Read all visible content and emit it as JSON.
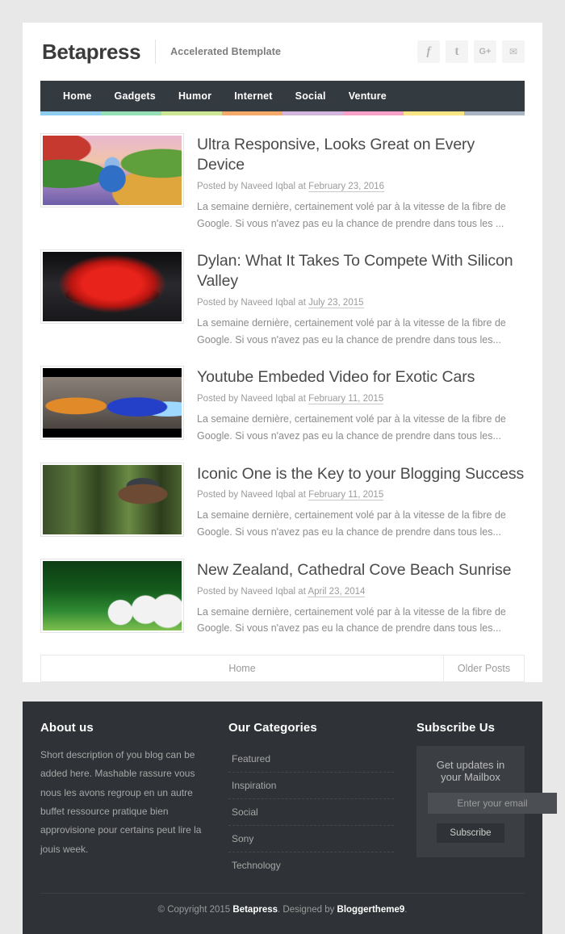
{
  "header": {
    "brand": "Betapress",
    "tagline": "Accelerated Btemplate",
    "social": [
      {
        "name": "facebook-icon",
        "glyph": "f"
      },
      {
        "name": "tumblr-icon",
        "glyph": "t"
      },
      {
        "name": "googleplus-icon",
        "glyph": "G+"
      },
      {
        "name": "email-icon",
        "glyph": "✉"
      }
    ]
  },
  "nav": {
    "items": [
      {
        "label": "Home"
      },
      {
        "label": "Gadgets"
      },
      {
        "label": "Humor"
      },
      {
        "label": "Internet"
      },
      {
        "label": "Social"
      },
      {
        "label": "Venture"
      }
    ],
    "stripe_colors": [
      "#8ecdf0",
      "#97e0b6",
      "#cbe694",
      "#f7a96a",
      "#d3b5de",
      "#f9a0c8",
      "#fbe585",
      "#aab5c4"
    ]
  },
  "posts": [
    {
      "title": "Ultra Responsive, Looks Great on Every Device",
      "meta_prefix": "Posted by Naveed Iqbal at ",
      "date": "February 23, 2016",
      "snippet": "La semaine dernière, certainement volé par à la vitesse de la fibre de Google. Si vous n'avez pas eu la chance de prendre dans tous les ...",
      "thumb": "fantasy-illustration-thumbnail"
    },
    {
      "title": "Dylan: What It Takes To Compete With Silicon Valley",
      "meta_prefix": "Posted by Naveed Iqbal at ",
      "date": "July 23, 2015",
      "snippet": "La semaine dernière, certainement volé par à la vitesse de la fibre de Google. Si vous n'avez pas eu la chance de prendre dans tous les...",
      "thumb": "red-sports-car-thumbnail"
    },
    {
      "title": "Youtube Embeded Video for Exotic Cars",
      "meta_prefix": "Posted by Naveed Iqbal at ",
      "date": "February 11, 2015",
      "snippet": "La semaine dernière, certainement volé par à la vitesse de la fibre de Google. Si vous n'avez pas eu la chance de prendre dans tous les...",
      "thumb": "snail-racer-thumbnail"
    },
    {
      "title": "Iconic One is the Key to your Blogging Success",
      "meta_prefix": "Posted by Naveed Iqbal at ",
      "date": "February 11, 2015",
      "snippet": "La semaine dernière, certainement volé par à la vitesse de la fibre de Google. Si vous n'avez pas eu la chance de prendre dans tous les...",
      "thumb": "forest-treehouse-thumbnail"
    },
    {
      "title": "New Zealand, Cathedral Cove Beach Sunrise",
      "meta_prefix": "Posted by Naveed Iqbal at ",
      "date": "April 23, 2014",
      "snippet": "La semaine dernière, certainement volé par à la vitesse de la fibre de Google. Si vous n'avez pas eu la chance de prendre dans tous les...",
      "thumb": "soccer-balls-thumbnail"
    }
  ],
  "pagination": {
    "home_label": "Home",
    "older_label": "Older Posts"
  },
  "footer": {
    "about": {
      "title": "About us",
      "text": "Short description of you blog can be added here. Mashable rassure vous nous les avons regroup en un autre buffet ressource pratique bien approvisione pour certains peut lire la jouis week."
    },
    "categories": {
      "title": "Our Categories",
      "items": [
        {
          "label": "Featured"
        },
        {
          "label": "Inspiration"
        },
        {
          "label": "Social"
        },
        {
          "label": "Sony"
        },
        {
          "label": "Technology"
        }
      ]
    },
    "subscribe": {
      "title": "Subscribe Us",
      "box_label": "Get updates in your Mailbox",
      "input_value": "",
      "input_placeholder": "Enter your email",
      "button_label": "Subscribe"
    },
    "copyright": {
      "prefix": "© Copyright 2015 ",
      "brand": "Betapress",
      "middle": ". Designed by ",
      "designer": "Bloggertheme9",
      "suffix": "."
    }
  },
  "colors": {
    "nav_bg": "#333a40",
    "footer_bg": "#2f3236",
    "page_bg": "#e8e8e8"
  }
}
